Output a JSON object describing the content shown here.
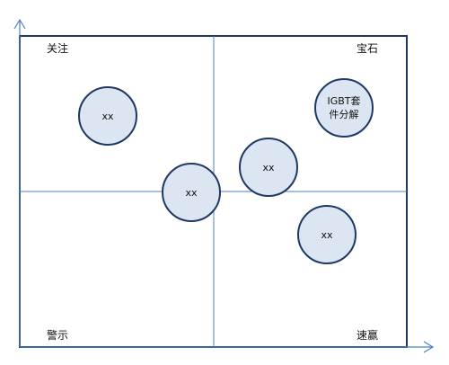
{
  "quadrants": {
    "top_left": "关注",
    "top_right": "宝石",
    "bottom_left": "警示",
    "bottom_right": "速赢"
  },
  "bubbles": [
    {
      "id": "b1",
      "label": "xx"
    },
    {
      "id": "b2",
      "label": "IGBT套件分解"
    },
    {
      "id": "b3",
      "label": "xx"
    },
    {
      "id": "b4",
      "label": "xx"
    },
    {
      "id": "b5",
      "label": "xx"
    }
  ],
  "colors": {
    "axis": "#4f81bd",
    "frame": "#1f3864",
    "bubble_fill": "#dce6f2",
    "bubble_border": "#1f3864"
  }
}
